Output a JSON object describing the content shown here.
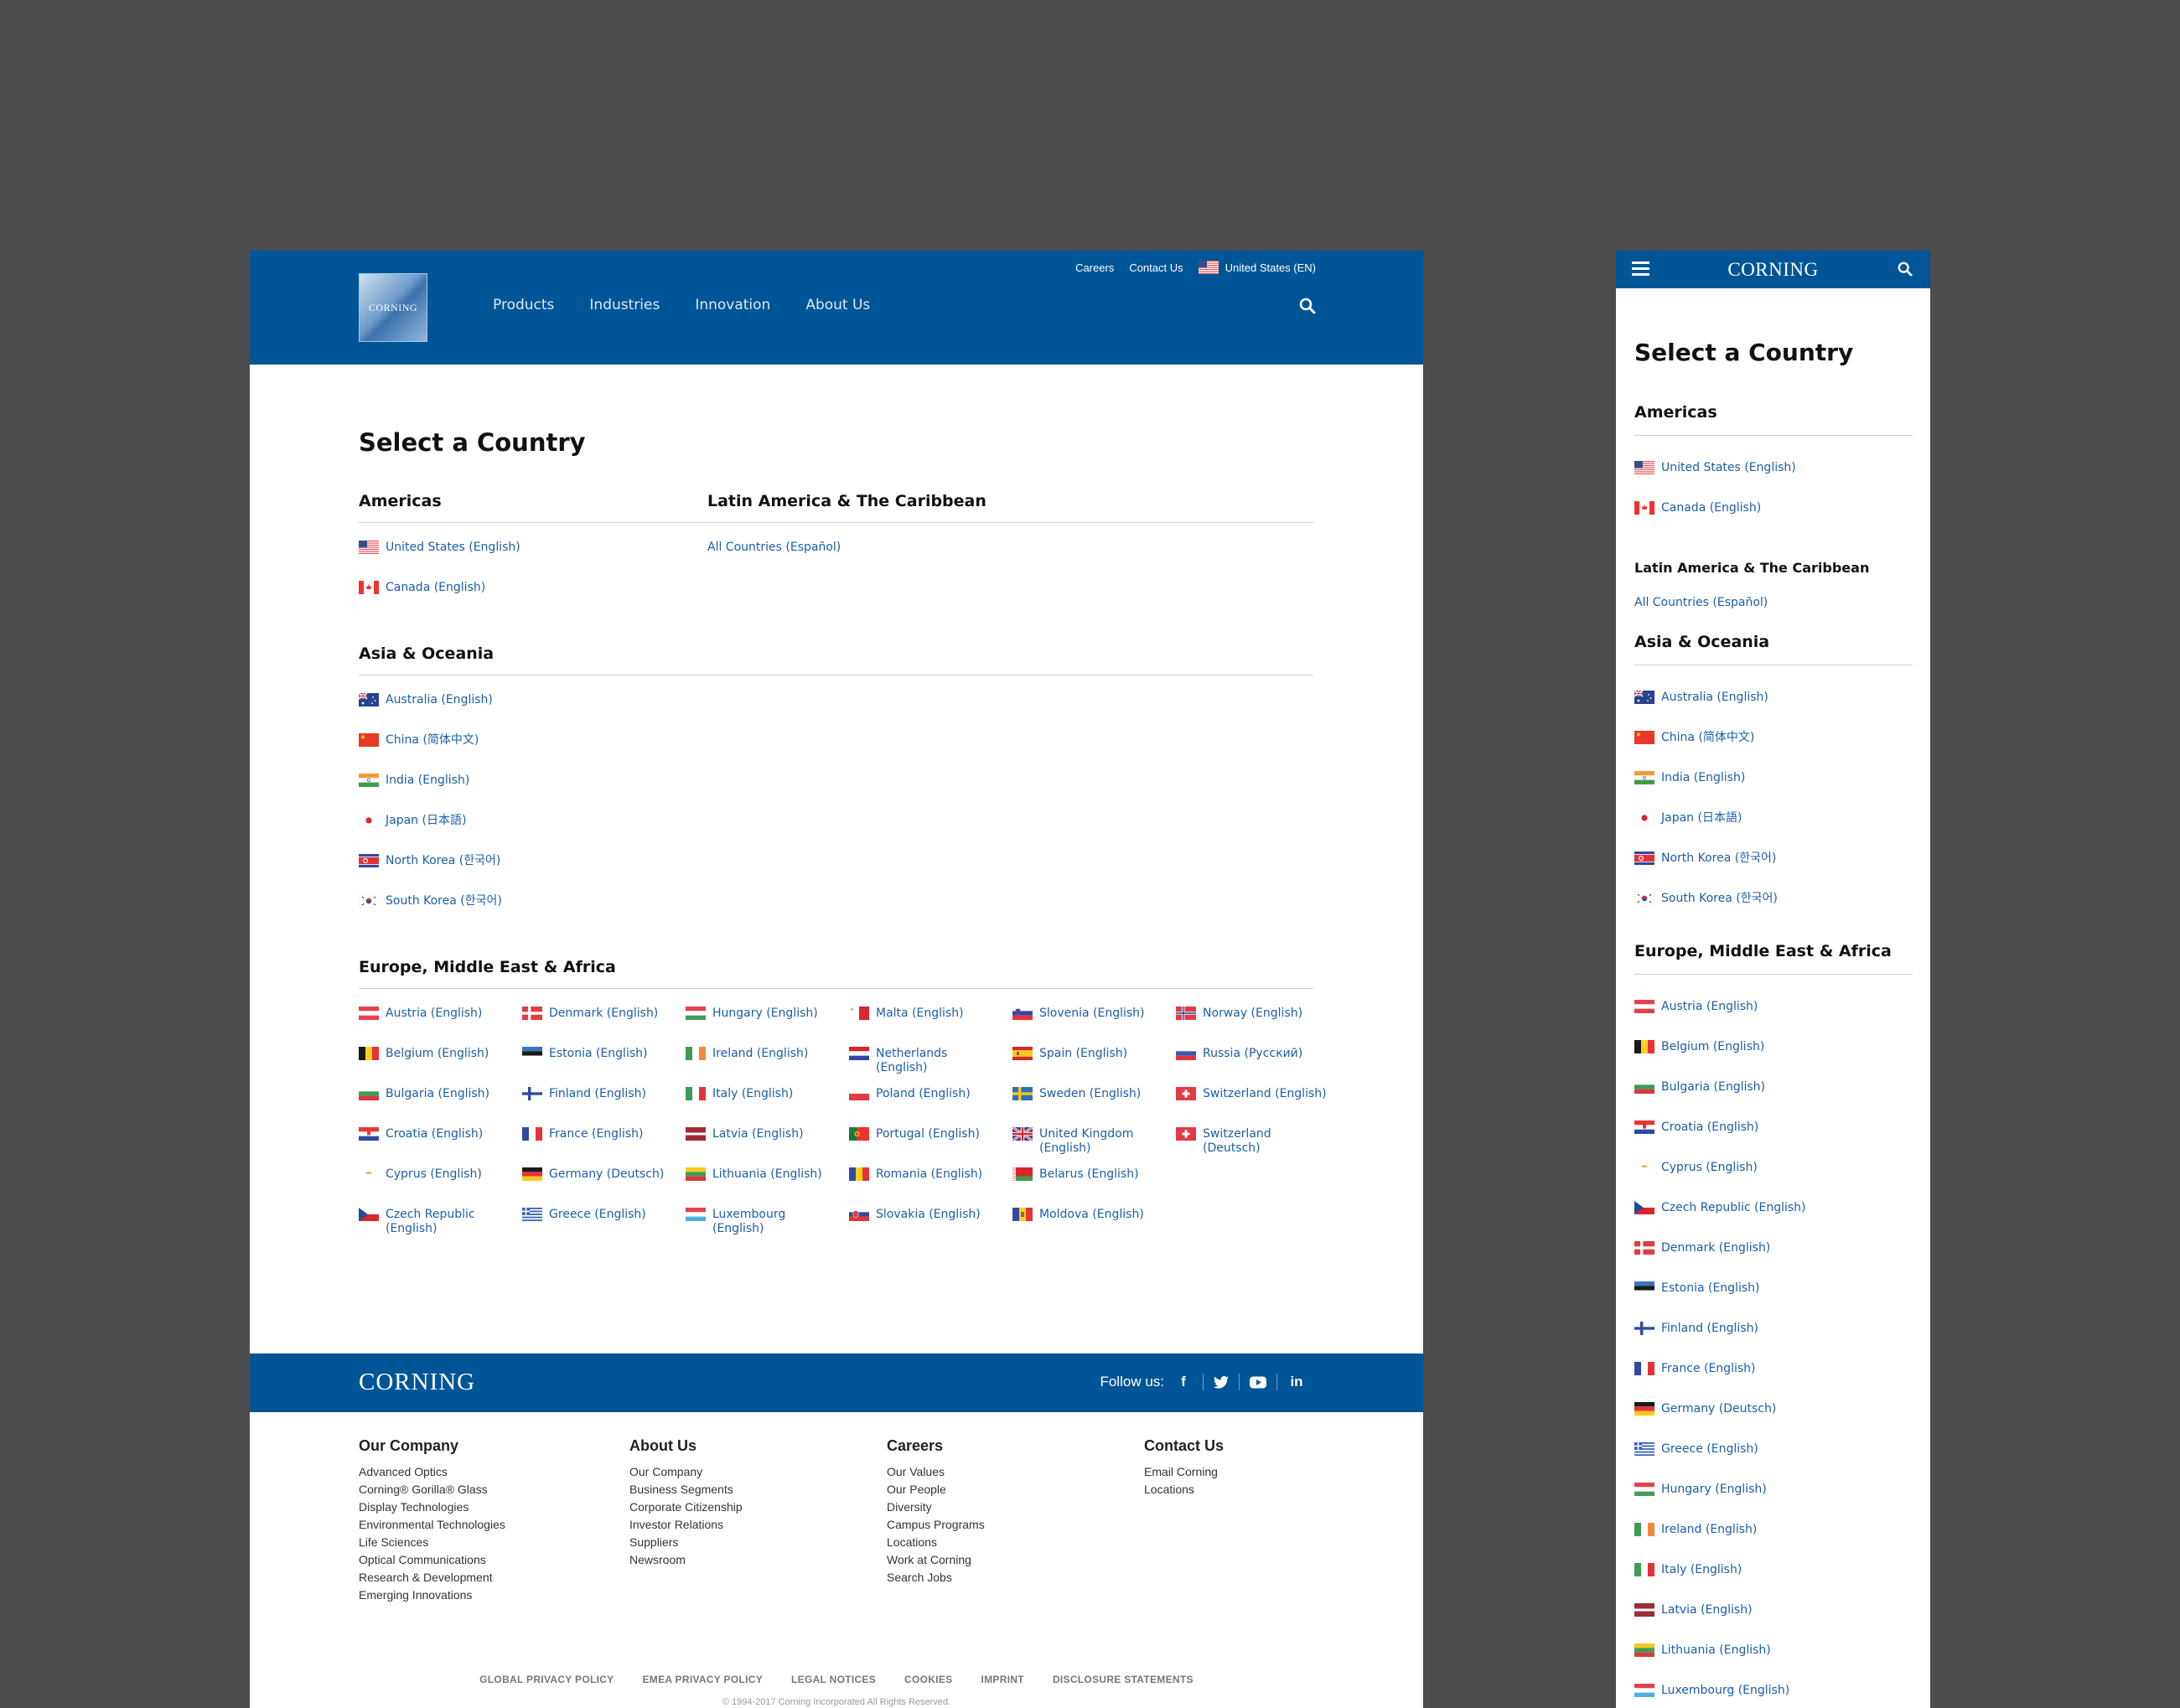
{
  "colors": {
    "brand_blue": "#005596",
    "link_blue": "#1a5ea8",
    "canvas_gray": "#4d4d4d"
  },
  "desktop": {
    "header": {
      "logo_text": "CORNING",
      "nav": [
        "Products",
        "Industries",
        "Innovation",
        "About Us"
      ],
      "utility": {
        "careers": "Careers",
        "contact": "Contact Us",
        "locale": "United States (EN)",
        "locale_flag": "us"
      },
      "search_icon": "search-icon"
    },
    "title": "Select a Country",
    "americas": {
      "heading": "Americas",
      "items": [
        {
          "label": "United States (English)",
          "flag": "us"
        },
        {
          "label": "Canada (English)",
          "flag": "ca"
        }
      ]
    },
    "latam": {
      "heading": "Latin America & The Caribbean",
      "items": [
        {
          "label": "All Countries (Español)",
          "flag": ""
        }
      ]
    },
    "asia": {
      "heading": "Asia & Oceania",
      "items": [
        {
          "label": "Australia (English)",
          "flag": "au"
        },
        {
          "label": "China (简体中文)",
          "flag": "cn"
        },
        {
          "label": "India (English)",
          "flag": "in"
        },
        {
          "label": "Japan (日本語)",
          "flag": "jp"
        },
        {
          "label": "North Korea (한국어)",
          "flag": "kp"
        },
        {
          "label": "South Korea (한국어)",
          "flag": "kr"
        }
      ]
    },
    "emea": {
      "heading": "Europe, Middle East & Africa",
      "items": [
        {
          "label": "Austria (English)",
          "flag": "at"
        },
        {
          "label": "Belgium (English)",
          "flag": "be"
        },
        {
          "label": "Bulgaria (English)",
          "flag": "bg"
        },
        {
          "label": "Croatia (English)",
          "flag": "hr"
        },
        {
          "label": "Cyprus (English)",
          "flag": "cy"
        },
        {
          "label": "Czech Republic (English)",
          "flag": "cz"
        },
        {
          "label": "Denmark (English)",
          "flag": "dk"
        },
        {
          "label": "Estonia (English)",
          "flag": "ee"
        },
        {
          "label": "Finland (English)",
          "flag": "fi"
        },
        {
          "label": "France (English)",
          "flag": "fr"
        },
        {
          "label": "Germany (Deutsch)",
          "flag": "de"
        },
        {
          "label": "Greece (English)",
          "flag": "gr"
        },
        {
          "label": "Hungary (English)",
          "flag": "hu"
        },
        {
          "label": "Ireland (English)",
          "flag": "ie"
        },
        {
          "label": "Italy (English)",
          "flag": "it"
        },
        {
          "label": "Latvia (English)",
          "flag": "lv"
        },
        {
          "label": "Lithuania (English)",
          "flag": "lt"
        },
        {
          "label": "Luxembourg (English)",
          "flag": "lu"
        },
        {
          "label": "Malta (English)",
          "flag": "mt"
        },
        {
          "label": "Netherlands (English)",
          "flag": "nl"
        },
        {
          "label": "Poland (English)",
          "flag": "pl"
        },
        {
          "label": "Portugal (English)",
          "flag": "pt"
        },
        {
          "label": "Romania (English)",
          "flag": "ro"
        },
        {
          "label": "Slovakia (English)",
          "flag": "sk"
        },
        {
          "label": "Slovenia (English)",
          "flag": "si"
        },
        {
          "label": "Spain (English)",
          "flag": "es"
        },
        {
          "label": "Sweden (English)",
          "flag": "se"
        },
        {
          "label": "United Kingdom (English)",
          "flag": "gb"
        },
        {
          "label": "Belarus (English)",
          "flag": "by"
        },
        {
          "label": "Moldova (English)",
          "flag": "md"
        },
        {
          "label": "Norway (English)",
          "flag": "no"
        },
        {
          "label": "Russia (Русский)",
          "flag": "ru"
        },
        {
          "label": "Switzerland (English)",
          "flag": "ch"
        },
        {
          "label": "Switzerland (Deutsch)",
          "flag": "ch"
        }
      ]
    },
    "footer": {
      "wordmark": "CORNING",
      "follow_label": "Follow us:",
      "social": [
        {
          "name": "facebook-icon",
          "glyph": "f"
        },
        {
          "name": "twitter-icon",
          "glyph": "🐦"
        },
        {
          "name": "youtube-icon",
          "glyph": "▶"
        },
        {
          "name": "linkedin-icon",
          "glyph": "in"
        }
      ],
      "columns": [
        {
          "heading": "Our Company",
          "links": [
            "Advanced Optics",
            "Corning® Gorilla® Glass",
            "Display Technologies",
            "Environmental Technologies",
            "Life Sciences",
            "Optical Communications",
            "Research & Development",
            "Emerging Innovations"
          ]
        },
        {
          "heading": "About Us",
          "links": [
            "Our Company",
            "Business Segments",
            "Corporate Citizenship",
            "Investor Relations",
            "Suppliers",
            "Newsroom"
          ]
        },
        {
          "heading": "Careers",
          "links": [
            "Our Values",
            "Our People",
            "Diversity",
            "Campus Programs",
            "Locations",
            "Work at Corning",
            "Search Jobs"
          ]
        },
        {
          "heading": "Contact Us",
          "links": [
            "Email Corning",
            "Locations"
          ]
        }
      ],
      "legal": [
        "GLOBAL PRIVACY POLICY",
        "EMEA PRIVACY POLICY",
        "LEGAL NOTICES",
        "COOKIES",
        "IMPRINT",
        "DISCLOSURE STATEMENTS"
      ],
      "copyright": "© 1994-2017 Corning Incorporated All Rights Reserved."
    }
  },
  "mobile": {
    "wordmark": "CORNING",
    "title": "Select a Country",
    "americas": {
      "heading": "Americas",
      "items": [
        {
          "label": "United States (English)",
          "flag": "us"
        },
        {
          "label": "Canada (English)",
          "flag": "ca"
        }
      ]
    },
    "latam": {
      "heading": "Latin America & The Caribbean",
      "link": "All Countries (Español)"
    },
    "asia": {
      "heading": "Asia & Oceania",
      "items": [
        {
          "label": "Australia (English)",
          "flag": "au"
        },
        {
          "label": "China (简体中文)",
          "flag": "cn"
        },
        {
          "label": "India (English)",
          "flag": "in"
        },
        {
          "label": "Japan (日本語)",
          "flag": "jp"
        },
        {
          "label": "North Korea (한국어)",
          "flag": "kp"
        },
        {
          "label": "South Korea (한국어)",
          "flag": "kr"
        }
      ]
    },
    "emea": {
      "heading": "Europe, Middle East & Africa",
      "items": [
        {
          "label": "Austria (English)",
          "flag": "at"
        },
        {
          "label": "Belgium (English)",
          "flag": "be"
        },
        {
          "label": "Bulgaria (English)",
          "flag": "bg"
        },
        {
          "label": "Croatia (English)",
          "flag": "hr"
        },
        {
          "label": "Cyprus (English)",
          "flag": "cy"
        },
        {
          "label": "Czech Republic (English)",
          "flag": "cz"
        },
        {
          "label": "Denmark (English)",
          "flag": "dk"
        },
        {
          "label": "Estonia (English)",
          "flag": "ee"
        },
        {
          "label": "Finland (English)",
          "flag": "fi"
        },
        {
          "label": "France (English)",
          "flag": "fr"
        },
        {
          "label": "Germany (Deutsch)",
          "flag": "de"
        },
        {
          "label": "Greece (English)",
          "flag": "gr"
        },
        {
          "label": "Hungary (English)",
          "flag": "hu"
        },
        {
          "label": "Ireland (English)",
          "flag": "ie"
        },
        {
          "label": "Italy (English)",
          "flag": "it"
        },
        {
          "label": "Latvia (English)",
          "flag": "lv"
        },
        {
          "label": "Lithuania (English)",
          "flag": "lt"
        },
        {
          "label": "Luxembourg (English)",
          "flag": "lu"
        }
      ]
    }
  }
}
